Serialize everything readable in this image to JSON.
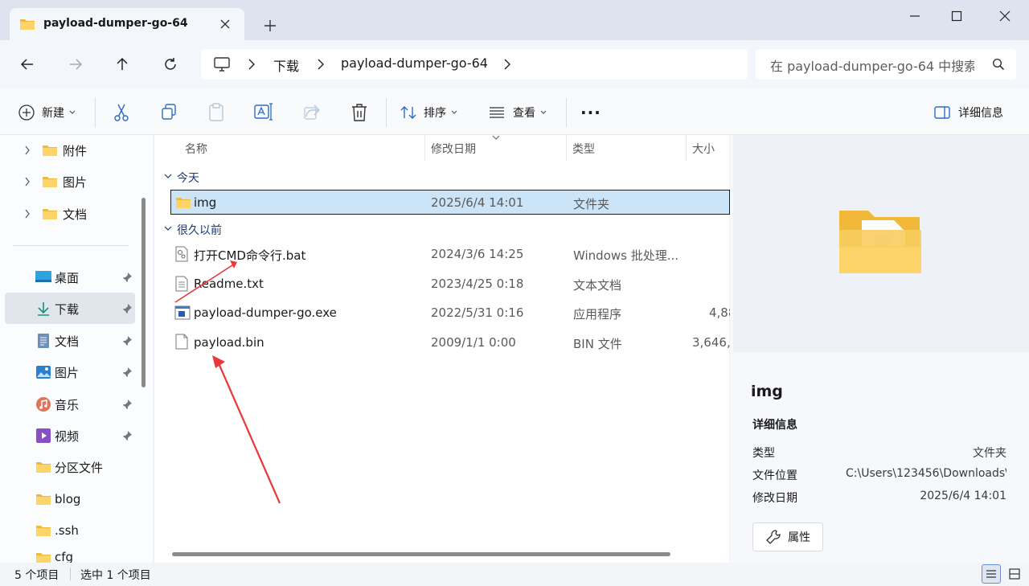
{
  "window": {
    "tab_title": "payload-dumper-go-64",
    "controls": [
      "minimize-icon",
      "maximize-icon",
      "close-icon"
    ]
  },
  "address": {
    "crumbs": [
      "下载",
      "payload-dumper-go-64"
    ],
    "search_placeholder": "在 payload-dumper-go-64 中搜索"
  },
  "toolbar": {
    "new_label": "新建",
    "sort_label": "排序",
    "view_label": "查看",
    "more_label": "···",
    "details_label": "详细信息"
  },
  "sidebar": {
    "tree": [
      {
        "label": "附件"
      },
      {
        "label": "图片"
      },
      {
        "label": "文档"
      }
    ],
    "quick": [
      {
        "label": "桌面",
        "icon": "desktop-icon",
        "pinned": true
      },
      {
        "label": "下载",
        "icon": "download-icon",
        "pinned": true,
        "selected": true
      },
      {
        "label": "文档",
        "icon": "document-icon",
        "pinned": true
      },
      {
        "label": "图片",
        "icon": "picture-icon",
        "pinned": true
      },
      {
        "label": "音乐",
        "icon": "music-icon",
        "pinned": true
      },
      {
        "label": "视频",
        "icon": "video-icon",
        "pinned": true
      },
      {
        "label": "分区文件",
        "icon": "folder-icon",
        "pinned": false
      },
      {
        "label": "blog",
        "icon": "folder-icon",
        "pinned": false
      },
      {
        "label": ".ssh",
        "icon": "folder-icon",
        "pinned": false
      },
      {
        "label": "cfg",
        "icon": "folder-icon",
        "pinned": false
      }
    ]
  },
  "columns": [
    "名称",
    "修改日期",
    "类型",
    "大小"
  ],
  "groups": [
    {
      "label": "今天",
      "files": [
        {
          "name": "img",
          "date": "2025/6/4 14:01",
          "type": "文件夹",
          "size": "",
          "icon": "folder-icon",
          "selected": true
        }
      ]
    },
    {
      "label": "很久以前",
      "files": [
        {
          "name": "打开CMD命令行.bat",
          "date": "2024/3/6 14:25",
          "type": "Windows 批处理...",
          "size": "",
          "icon": "batch-file-icon"
        },
        {
          "name": "Readme.txt",
          "date": "2023/4/25 0:18",
          "type": "文本文档",
          "size": "",
          "icon": "text-file-icon"
        },
        {
          "name": "payload-dumper-go.exe",
          "date": "2022/5/31 0:16",
          "type": "应用程序",
          "size": "4,88",
          "icon": "exe-file-icon"
        },
        {
          "name": "payload.bin",
          "date": "2009/1/1 0:00",
          "type": "BIN 文件",
          "size": "3,646,",
          "icon": "blank-file-icon"
        }
      ]
    }
  ],
  "details": {
    "name": "img",
    "section": "详细信息",
    "rows": [
      {
        "key": "类型",
        "value": "文件夹"
      },
      {
        "key": "文件位置",
        "value": "C:\\Users\\123456\\Downloads\\..."
      },
      {
        "key": "修改日期",
        "value": "2025/6/4 14:01"
      }
    ],
    "properties_label": "属性"
  },
  "status": {
    "count": "5 个项目",
    "selection": "选中 1 个项目"
  },
  "colors": {
    "selection": "#cce4f7",
    "accent": "#0067c0",
    "annotation_arrow": "#e8383a",
    "folder": "#f7c948"
  }
}
